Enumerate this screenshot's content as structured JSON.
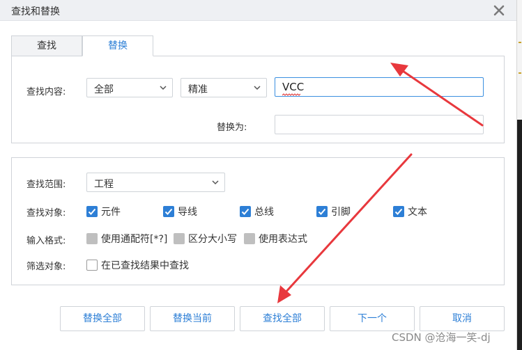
{
  "dialog": {
    "title": "查找和替换"
  },
  "tabs": [
    {
      "label": "查找",
      "active": false
    },
    {
      "label": "替换",
      "active": true
    }
  ],
  "search": {
    "find_label": "查找内容:",
    "scope_select": "全部",
    "mode_select": "精准",
    "find_value": "VCC",
    "replace_label": "替换为:",
    "replace_value": ""
  },
  "options": {
    "range_label": "查找范围:",
    "range_select": "工程",
    "objects_label": "查找对象:",
    "objects": [
      {
        "label": "元件",
        "checked": true
      },
      {
        "label": "导线",
        "checked": true
      },
      {
        "label": "总线",
        "checked": true
      },
      {
        "label": "引脚",
        "checked": true
      },
      {
        "label": "文本",
        "checked": true
      }
    ],
    "format_label": "输入格式:",
    "formats": [
      {
        "label": "使用通配符[*?]",
        "checked": false
      },
      {
        "label": "区分大小写",
        "checked": false
      },
      {
        "label": "使用表达式",
        "checked": false
      }
    ],
    "filter_label": "筛选对象:",
    "filter": {
      "label": "在已查找结果中查找",
      "checked": false
    }
  },
  "buttons": {
    "replace_all": "替换全部",
    "replace_current": "替换当前",
    "find_all": "查找全部",
    "next": "下一个",
    "cancel": "取消"
  },
  "watermark": "CSDN @沧海一笑-dj",
  "colors": {
    "accent": "#2d7fd6",
    "annotation_arrow": "#e8383d",
    "titlebar": "#eef0f3",
    "border": "#cfd3d8"
  },
  "icons": {
    "close": "close-icon",
    "dropdown": "chevron-down-icon",
    "checkbox": "checkmark-icon"
  }
}
